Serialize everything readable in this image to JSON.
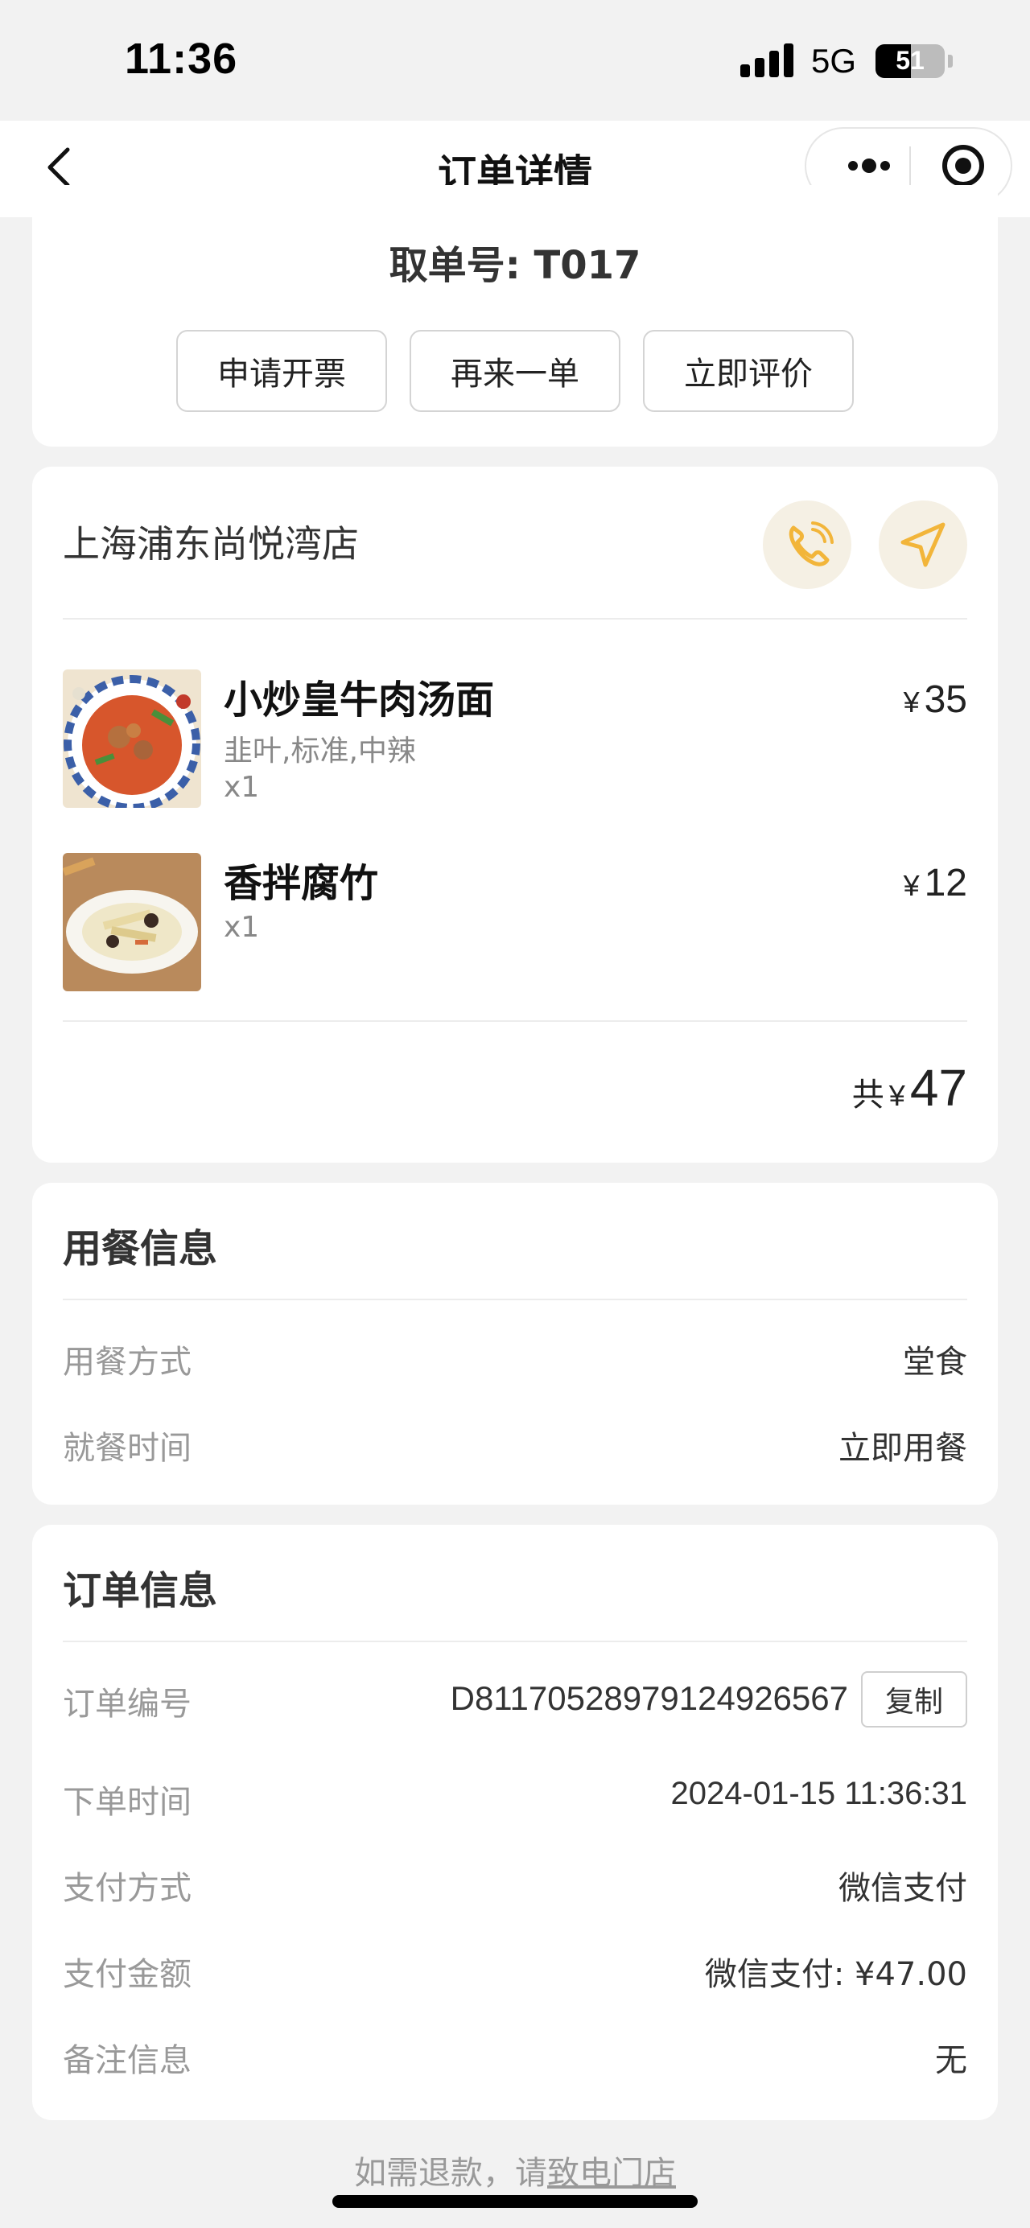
{
  "status_bar": {
    "time": "11:36",
    "network": "5G",
    "battery": "51",
    "battery_level": 0.51
  },
  "nav": {
    "title": "订单详情"
  },
  "pickup": {
    "label": "取单号: T017",
    "actions": [
      "申请开票",
      "再来一单",
      "立即评价"
    ]
  },
  "store": {
    "name": "上海浦东尚悦湾店",
    "items": [
      {
        "name": "小炒皇牛肉汤面",
        "spec": "韭叶,标准,中辣",
        "qty": "x1",
        "currency": "¥",
        "price": "35"
      },
      {
        "name": "香拌腐竹",
        "spec": "",
        "qty": "x1",
        "currency": "¥",
        "price": "12"
      }
    ],
    "total_label": "共",
    "total_currency": "¥",
    "total": "47"
  },
  "dine_info": {
    "title": "用餐信息",
    "rows": [
      {
        "key": "用餐方式",
        "value": "堂食"
      },
      {
        "key": "就餐时间",
        "value": "立即用餐"
      }
    ]
  },
  "order_info": {
    "title": "订单信息",
    "order_no_label": "订单编号",
    "order_no": "D8117052897912492656​7",
    "copy_label": "复制",
    "rows": [
      {
        "key": "下单时间",
        "value": "2024-01-15 11:36:31"
      },
      {
        "key": "支付方式",
        "value": "微信支付"
      },
      {
        "key": "支付金额",
        "value": "微信支付: ¥47.00"
      },
      {
        "key": "备注信息",
        "value": "无"
      }
    ]
  },
  "refund": {
    "prefix": "如需退款，请",
    "link": "致电门店"
  },
  "colors": {
    "accent": "#f2b53a",
    "accent_bg": "#f5f0e4",
    "page_bg": "#f2f2f2"
  }
}
